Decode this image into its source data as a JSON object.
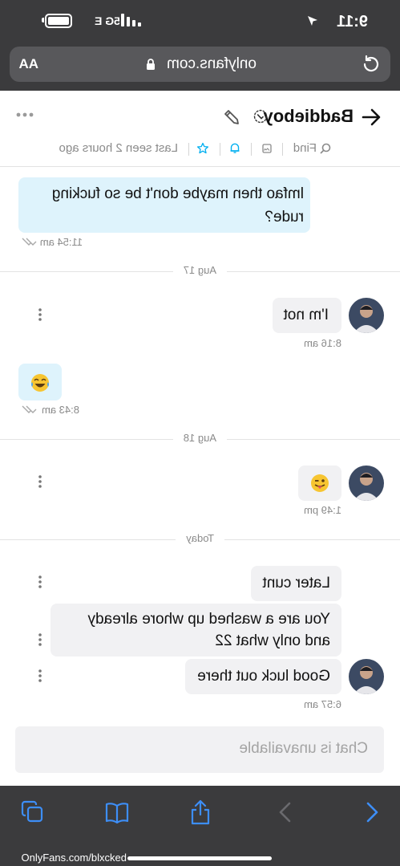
{
  "status_bar": {
    "time": "9:11",
    "network": "5G E"
  },
  "browser": {
    "url": "onlyfans.com",
    "text_size_label": "AA"
  },
  "chat": {
    "username": "Baddieboy",
    "last_seen": "Last seen 2 hours ago",
    "find_label": "Find"
  },
  "messages": [
    {
      "text_line1": "lmfao then maybe don't be so fucking",
      "text_line2": "rude?",
      "time": "11:54 am"
    },
    {
      "date": "Aug 17"
    },
    {
      "text": "I'm not",
      "time": "8:16 am"
    },
    {
      "emoji": "laughing-crying",
      "time": "8:43 am"
    },
    {
      "date": "Aug 18"
    },
    {
      "emoji": "winking-tongue",
      "time": "1:49 pm"
    },
    {
      "date": "Today"
    },
    {
      "text": "Later cunt"
    },
    {
      "text_line1": "You are a washed up whore already",
      "text_line2": "and only what 22"
    },
    {
      "text": "Good luck out there",
      "time": "6:57 am"
    }
  ],
  "composer": {
    "unavailable_text": "Chat is unavailable"
  },
  "watermark": "OnlyFans.com/blxcked",
  "colors": {
    "accent": "#00aff0",
    "received_bubble": "#def3fc",
    "sent_bubble": "#f1f1f3",
    "browser_chrome": "#3b3b3d",
    "toolbar_icon": "#3d8ef7"
  }
}
